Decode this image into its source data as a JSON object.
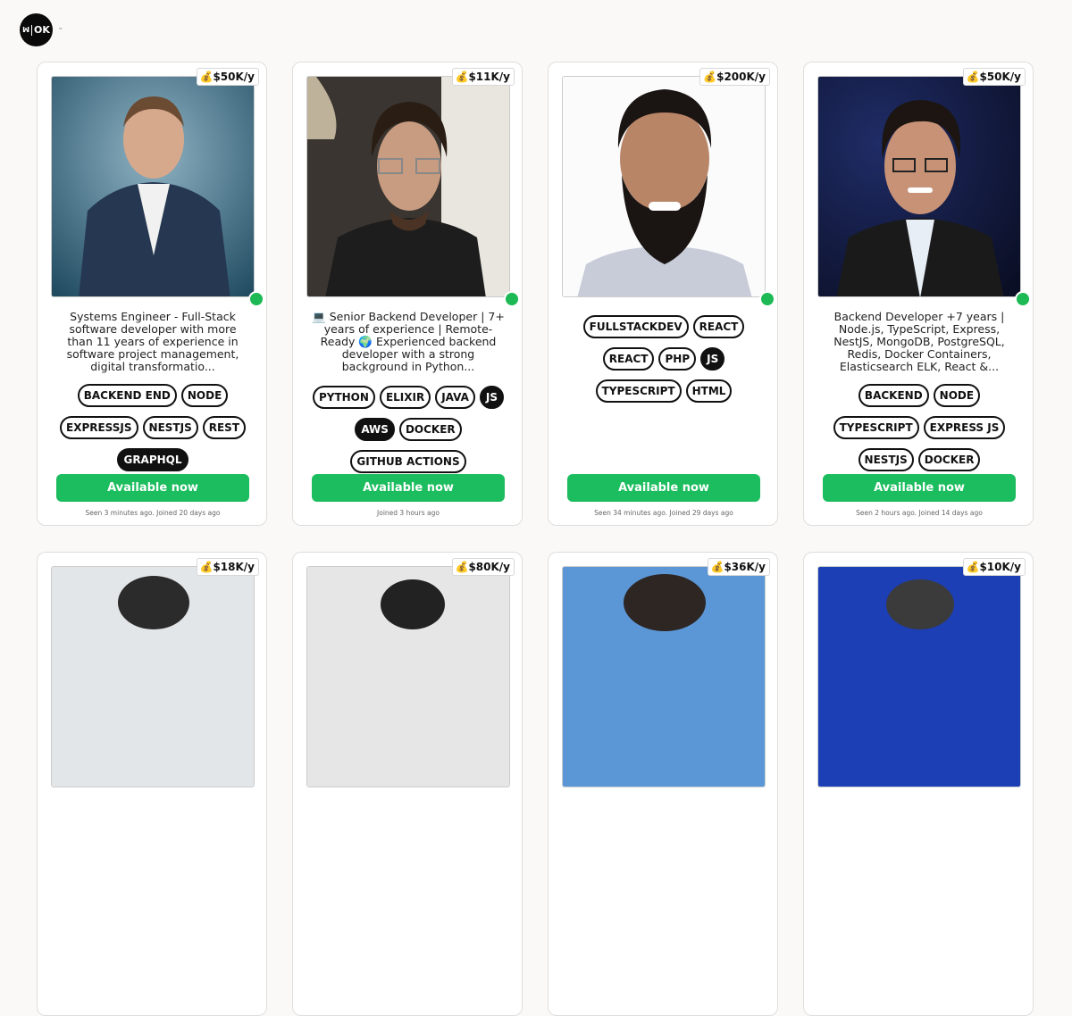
{
  "logo": {
    "text_left": "ꟽ",
    "text_right": "OK"
  },
  "cards": [
    {
      "salary": "💰$50K/y",
      "bio": "Systems Engineer - Full-Stack software developer with more than 11 years of experience in software project management, digital transformatio...",
      "tags": [
        "BACKEND END",
        "NODE",
        "EXPRESSJS",
        "NESTJS",
        "REST",
        "GRAPHQL"
      ],
      "active_tags": [
        "GRAPHQL"
      ],
      "cta": "Available now",
      "seen": "Seen 3 minutes ago. Joined 20 days ago"
    },
    {
      "salary": "💰$11K/y",
      "bio": "💻 Senior Backend Developer | 7+ years of experience | Remote-Ready 🌍 Experienced backend developer with a strong background in Python...",
      "tags": [
        "PYTHON",
        "ELIXIR",
        "JAVA",
        "JS",
        "AWS",
        "DOCKER",
        "GITHUB ACTIONS"
      ],
      "active_tags": [
        "JS",
        "AWS"
      ],
      "cta": "Available now",
      "seen": "Joined 3 hours ago"
    },
    {
      "salary": "💰$200K/y",
      "bio": "",
      "tags": [
        "FULLSTACKDEV",
        "REACT",
        "REACT",
        "PHP",
        "JS",
        "TYPESCRIPT",
        "HTML"
      ],
      "active_tags": [
        "JS"
      ],
      "cta": "Available now",
      "seen": "Seen 34 minutes ago. Joined 29 days ago"
    },
    {
      "salary": "💰$50K/y",
      "bio": "Backend Developer +7 years | Node.js, TypeScript, Express, NestJS, MongoDB, PostgreSQL, Redis, Docker Containers, Elasticsearch ELK, React &...",
      "tags": [
        "BACKEND",
        "NODE",
        "TYPESCRIPT",
        "EXPRESS JS",
        "NESTJS",
        "DOCKER"
      ],
      "active_tags": [],
      "cta": "Available now",
      "seen": "Seen 2 hours ago. Joined 14 days ago"
    }
  ],
  "second_row_salaries": [
    "💰$18K/y",
    "💰$80K/y",
    "💰$36K/y",
    "💰$10K/y"
  ],
  "colors": {
    "available": "#1cbd5e",
    "online": "#1db954",
    "tag_border": "#111111"
  }
}
